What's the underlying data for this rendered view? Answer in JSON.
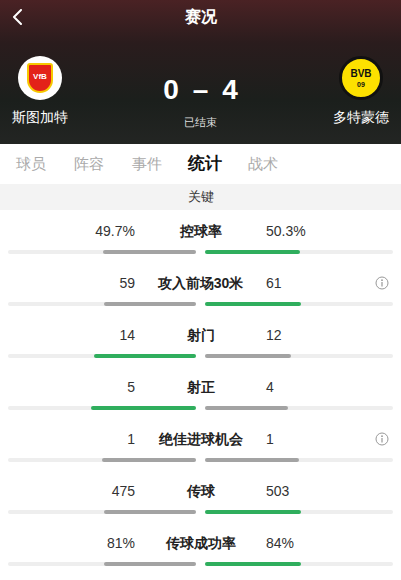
{
  "header": {
    "title": "赛况"
  },
  "match": {
    "home": {
      "name": "斯图加特",
      "score": "0",
      "logo_text": "VfB"
    },
    "away": {
      "name": "多特蒙德",
      "score": "4",
      "logo_text": [
        "BVB",
        "09"
      ]
    },
    "separator": "–",
    "status": "已结束"
  },
  "tabs": [
    {
      "label": "球员",
      "selected": false
    },
    {
      "label": "阵容",
      "selected": false
    },
    {
      "label": "事件",
      "selected": false
    },
    {
      "label": "统计",
      "selected": true
    },
    {
      "label": "战术",
      "selected": false
    }
  ],
  "section": {
    "title": "关键"
  },
  "stats": [
    {
      "label": "控球率",
      "info": false,
      "left": {
        "value": "49.7%",
        "level": 0.497,
        "leading": false
      },
      "right": {
        "value": "50.3%",
        "level": 0.503,
        "leading": true
      }
    },
    {
      "label": "攻入前场30米",
      "info": true,
      "left": {
        "value": "59",
        "level": 0.49,
        "leading": false
      },
      "right": {
        "value": "61",
        "level": 0.51,
        "leading": true
      }
    },
    {
      "label": "射门",
      "info": false,
      "left": {
        "value": "14",
        "level": 0.54,
        "leading": true
      },
      "right": {
        "value": "12",
        "level": 0.46,
        "leading": false
      }
    },
    {
      "label": "射正",
      "info": false,
      "left": {
        "value": "5",
        "level": 0.56,
        "leading": true
      },
      "right": {
        "value": "4",
        "level": 0.44,
        "leading": false
      }
    },
    {
      "label": "绝佳进球机会",
      "info": true,
      "left": {
        "value": "1",
        "level": 0.5,
        "leading": false
      },
      "right": {
        "value": "1",
        "level": 0.5,
        "leading": false
      }
    },
    {
      "label": "传球",
      "info": false,
      "left": {
        "value": "475",
        "level": 0.49,
        "leading": false
      },
      "right": {
        "value": "503",
        "level": 0.51,
        "leading": true
      }
    },
    {
      "label": "传球成功率",
      "info": false,
      "left": {
        "value": "81%",
        "level": 0.49,
        "leading": false
      },
      "right": {
        "value": "84%",
        "level": 0.51,
        "leading": true
      }
    }
  ]
}
